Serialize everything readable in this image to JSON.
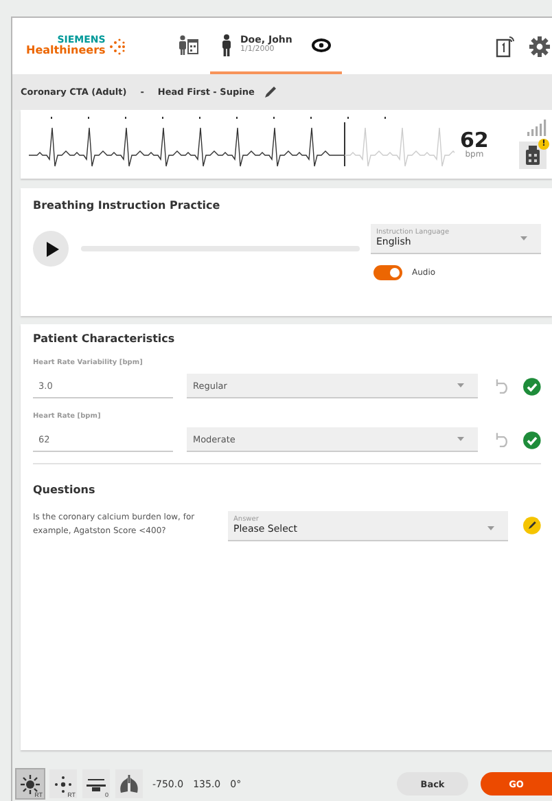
{
  "header": {
    "logo": {
      "brand": "SIEMENS",
      "product": "Healthineers"
    },
    "tabs": [
      {
        "kind": "schedule",
        "selected": false
      },
      {
        "kind": "patient",
        "name": "Doe, John",
        "dob": "1/1/2000",
        "selected": true
      }
    ]
  },
  "protocol": {
    "name": "Coronary CTA (Adult)",
    "separator": "-",
    "position": "Head First - Supine"
  },
  "ecg": {
    "heart_rate": "62",
    "unit": "bpm",
    "device_badge": "!"
  },
  "breathing": {
    "title": "Breathing Instruction Practice",
    "progress": {
      "level": 0
    },
    "language": {
      "label": "Instruction Language",
      "value": "English"
    },
    "audio": {
      "label": "Audio",
      "on": true
    }
  },
  "patient": {
    "title": "Patient Characteristics",
    "fields": [
      {
        "label": "Heart Rate Variability [bpm]",
        "value": "3.0",
        "select": "Regular",
        "confirmed": true
      },
      {
        "label": "Heart Rate [bpm]",
        "value": "62",
        "select": "Moderate",
        "confirmed": true
      }
    ]
  },
  "questions": {
    "title": "Questions",
    "items": [
      {
        "text": "Is the coronary calcium burden low, for example, Agatston Score <400?",
        "answer_label": "Answer",
        "answer": "Please Select",
        "pending": true
      }
    ]
  },
  "toolbar": {
    "tools": [
      {
        "kind": "sun",
        "sub": "RT",
        "selected": true
      },
      {
        "kind": "dots",
        "sub": "RT",
        "selected": false
      },
      {
        "kind": "table",
        "sub": "0",
        "selected": false
      },
      {
        "kind": "lungs",
        "selected": false
      }
    ],
    "readings": [
      "-750.0",
      "135.0",
      "0°"
    ],
    "buttons": [
      {
        "kind": "secondary",
        "label": "Back"
      },
      {
        "kind": "primary",
        "label": "GO"
      }
    ]
  }
}
